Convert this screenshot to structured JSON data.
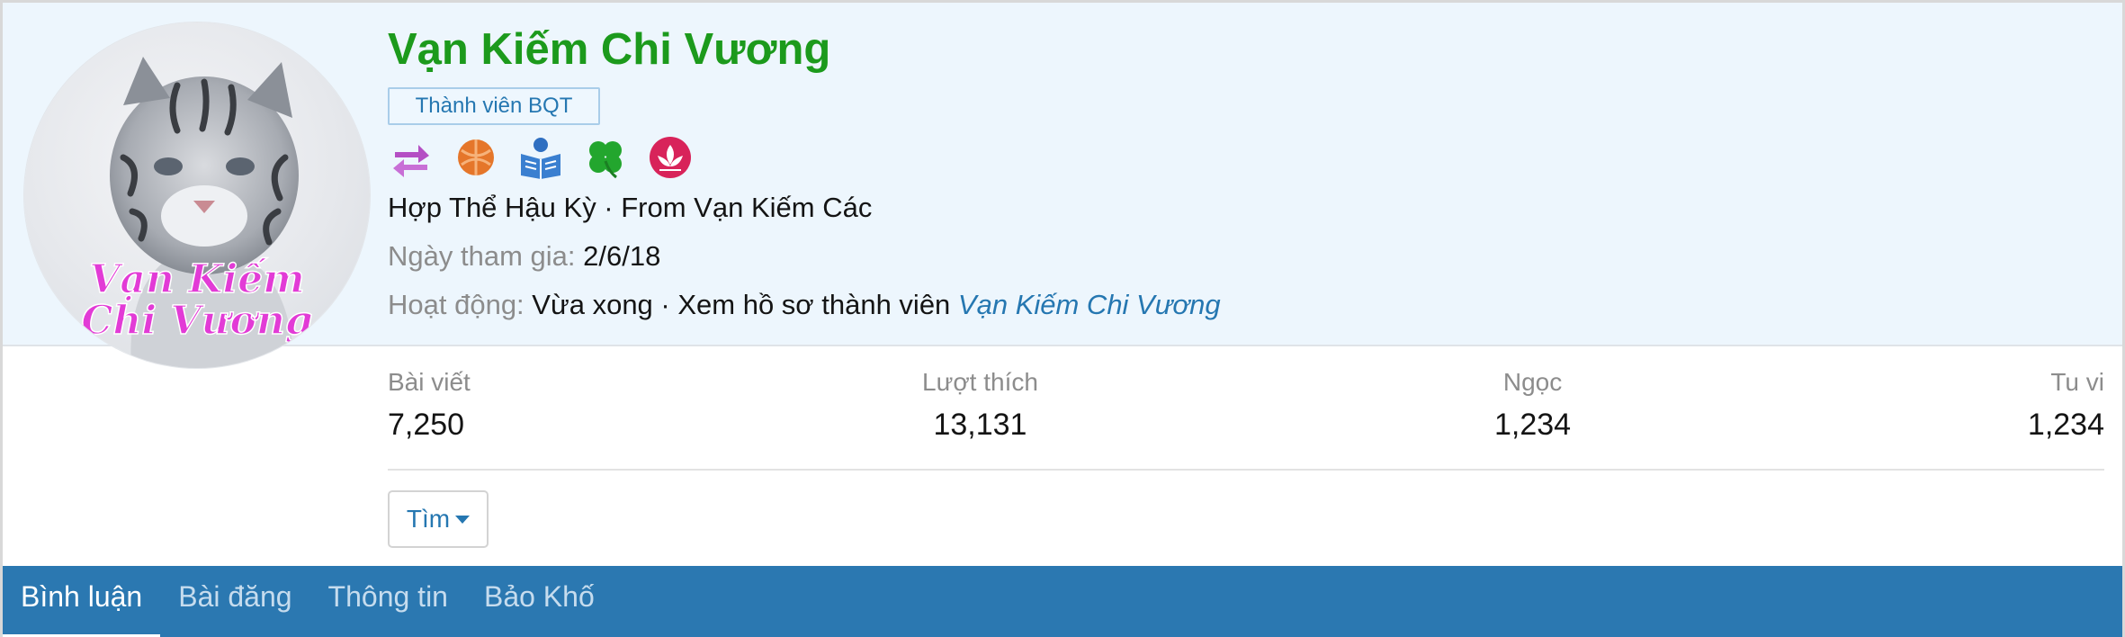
{
  "profile": {
    "name": "Vạn Kiếm Chi Vương",
    "name_color": "#1c9a1c",
    "banner": "Thành viên BQT",
    "avatar_caption": [
      "Vạn Kiếm",
      "Chi Vương"
    ],
    "badges": [
      "swap-arrows-icon",
      "orange-ball-icon",
      "reading-book-icon",
      "four-leaf-clover-icon",
      "lotus-icon"
    ],
    "title_line": "Hợp Thể Hậu Kỳ · From Vạn Kiếm Các",
    "joined_label": "Ngày tham gia:",
    "joined_value": "2/6/18",
    "activity_label": "Hoạt động:",
    "activity_value": "Vừa xong · Xem hồ sơ thành viên",
    "activity_link": "Vạn Kiếm Chi Vương"
  },
  "stats": [
    {
      "label": "Bài viết",
      "value": "7,250"
    },
    {
      "label": "Lượt thích",
      "value": "13,131"
    },
    {
      "label": "Ngọc",
      "value": "1,234"
    },
    {
      "label": "Tu vi",
      "value": "1,234"
    }
  ],
  "actions": {
    "find_label": "Tìm"
  },
  "tabs": [
    {
      "label": "Bình luận",
      "active": true
    },
    {
      "label": "Bài đăng",
      "active": false
    },
    {
      "label": "Thông tin",
      "active": false
    },
    {
      "label": "Bảo Khố",
      "active": false
    }
  ],
  "colors": {
    "accent": "#2577b1",
    "tab_bar": "#2b78b1",
    "header_bg": "#edf6fd"
  }
}
